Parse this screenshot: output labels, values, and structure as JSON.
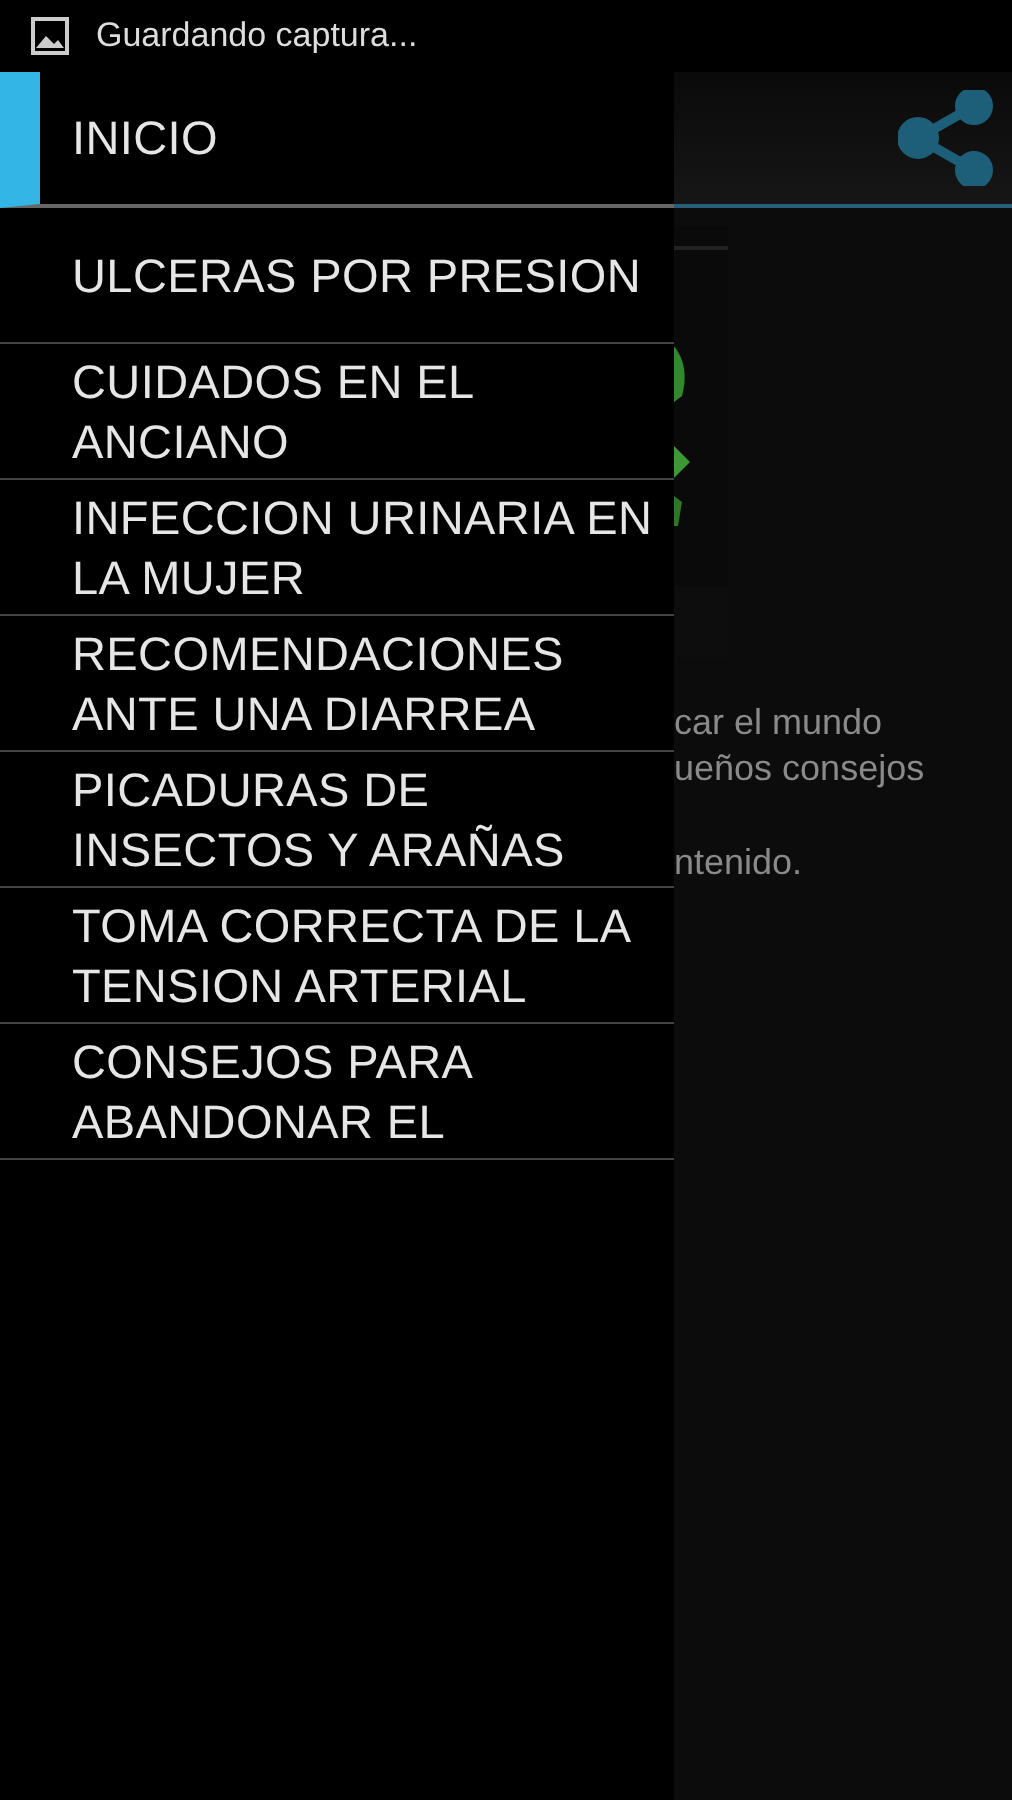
{
  "status_bar": {
    "notification": "Guardando captura..."
  },
  "drawer": {
    "items": [
      {
        "label": "INICIO",
        "selected": true
      },
      {
        "label": "ULCERAS POR PRESION",
        "selected": false
      },
      {
        "label": "CUIDADOS EN EL ANCIANO",
        "selected": false
      },
      {
        "label": "INFECCION URINARIA EN LA MUJER",
        "selected": false
      },
      {
        "label": "RECOMENDACIONES ANTE UNA DIARREA",
        "selected": false
      },
      {
        "label": "PICADURAS DE INSECTOS Y ARAÑAS",
        "selected": false
      },
      {
        "label": "TOMA CORRECTA DE LA TENSION ARTERIAL",
        "selected": false
      },
      {
        "label": "CONSEJOS PARA ABANDONAR EL",
        "selected": false
      }
    ]
  },
  "content": {
    "lines": [
      "car el mundo",
      "ueños consejos",
      "ntenido."
    ]
  }
}
